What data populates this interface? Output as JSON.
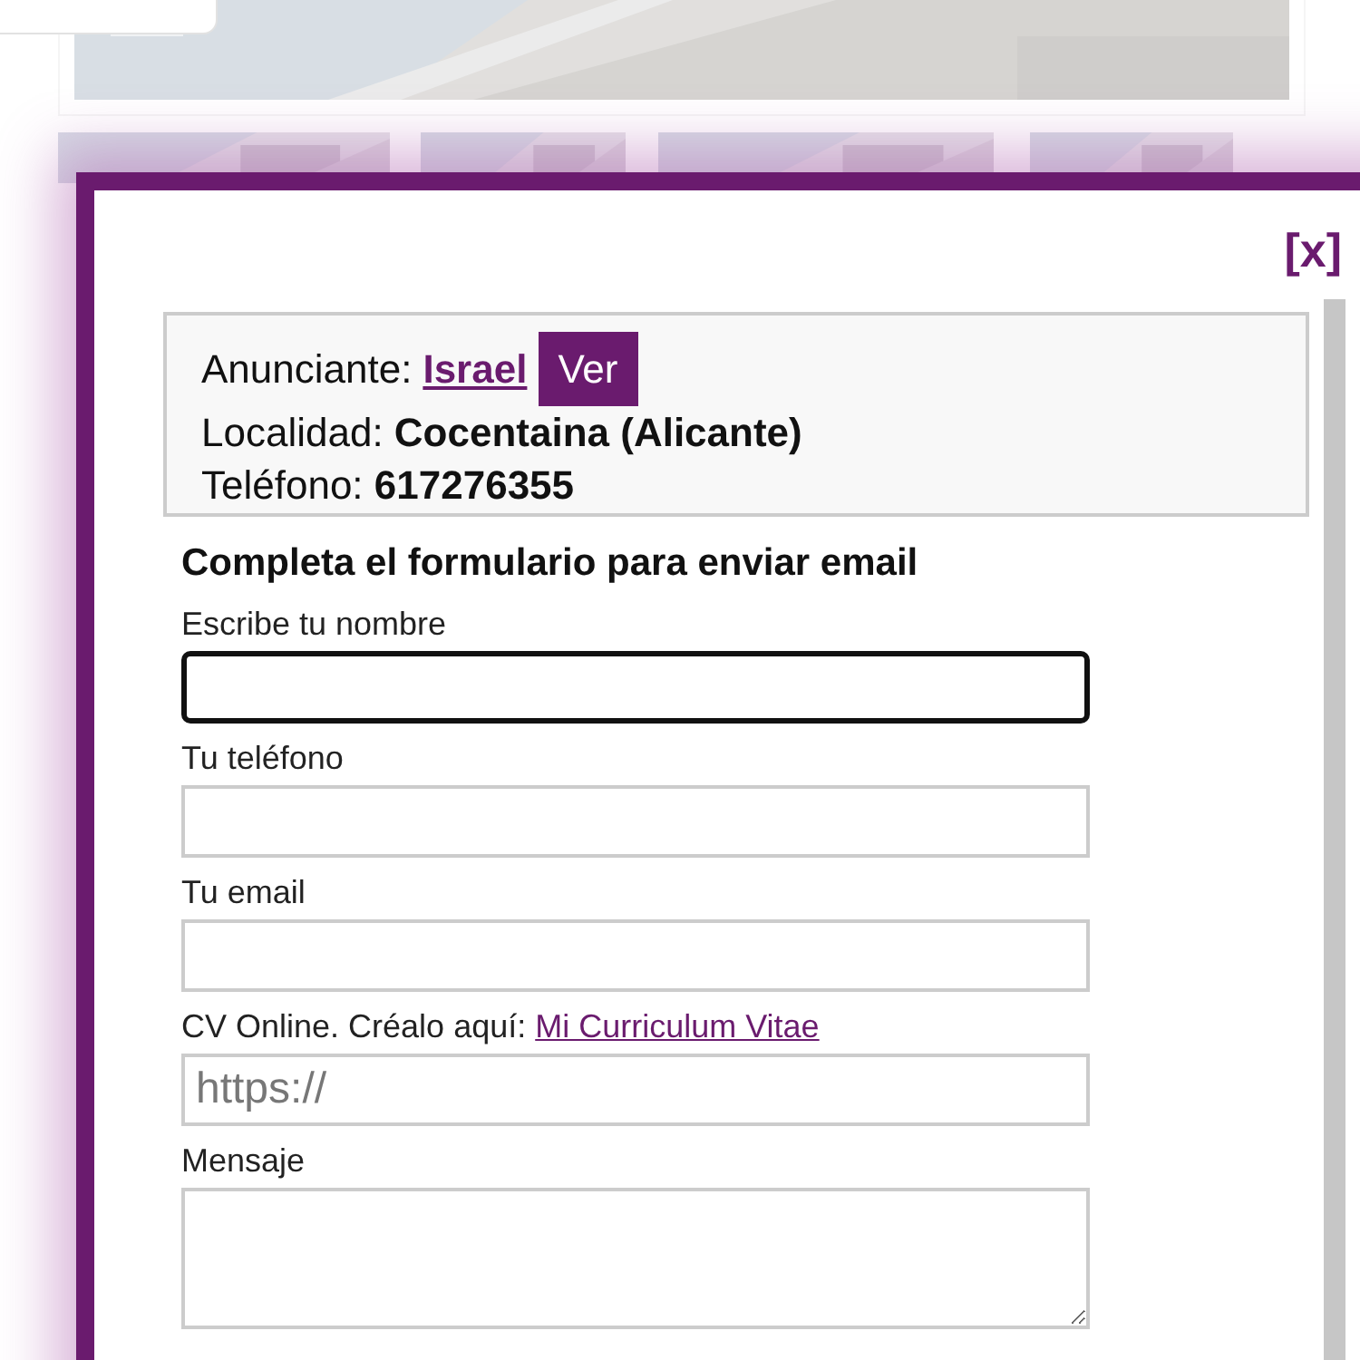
{
  "modal": {
    "close": "[x]",
    "advertiser": {
      "label": "Anunciante:",
      "name": "Israel",
      "button": "Ver"
    },
    "details": [
      "Localidad: **Cocentaina (Alicante)**",
      "Teléfono: **617276355**"
    ],
    "heading": "Completa el formulario para enviar email",
    "fields": [
      {
        "kind": "input",
        "label": "Escribe tu nombre",
        "focused": true
      },
      {
        "kind": "input",
        "label": "Tu teléfono",
        "focused": false
      },
      {
        "kind": "input",
        "label": "Tu email",
        "focused": false
      },
      {
        "kind": "input",
        "label": "CV Online. Créalo aquí:",
        "link": "Mi Curriculum Vitae",
        "placeholder": "https://",
        "focused": false
      },
      {
        "kind": "textarea",
        "label": "Mensaje",
        "focused": false
      }
    ]
  }
}
